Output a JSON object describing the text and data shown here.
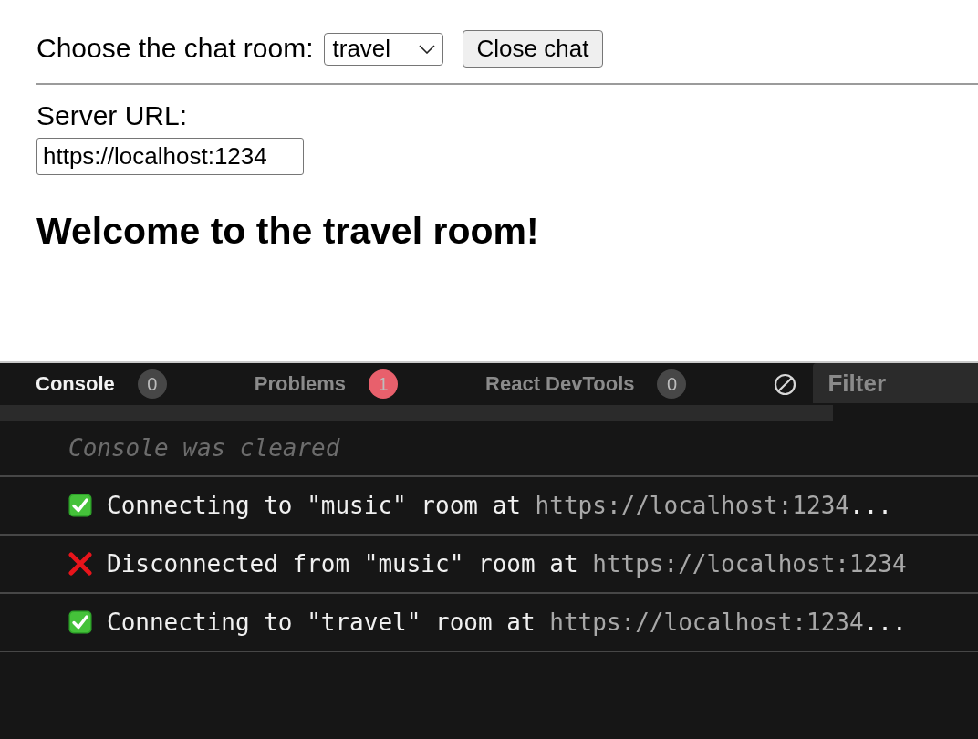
{
  "chat_controls": {
    "room_label": "Choose the chat room:",
    "room_select": {
      "value": "travel"
    },
    "close_button": "Close chat"
  },
  "server": {
    "label": "Server URL:",
    "url_field": {
      "value": "https://localhost:1234"
    }
  },
  "heading": "Welcome to the travel room!",
  "devtools": {
    "tabs": [
      {
        "label": "Console",
        "count": "0",
        "color": "#474747",
        "selected": true
      },
      {
        "label": "Problems",
        "count": "1",
        "color": "#e8606c",
        "selected": false
      },
      {
        "label": "React DevTools",
        "count": "0",
        "color": "#474747",
        "selected": false
      }
    ],
    "filter": {
      "placeholder": "Filter"
    },
    "log": [
      {
        "kind": "notice",
        "message": "Console was cleared"
      },
      {
        "kind": "success",
        "message": "Connecting to \"music\" room at",
        "url": "https://localhost:1234",
        "suffix": "..."
      },
      {
        "kind": "error",
        "message": "Disconnected from \"music\" room at",
        "url": "https://localhost:1234"
      },
      {
        "kind": "success",
        "message": "Connecting to \"travel\" room at",
        "url": "https://localhost:1234",
        "suffix": "..."
      }
    ]
  }
}
